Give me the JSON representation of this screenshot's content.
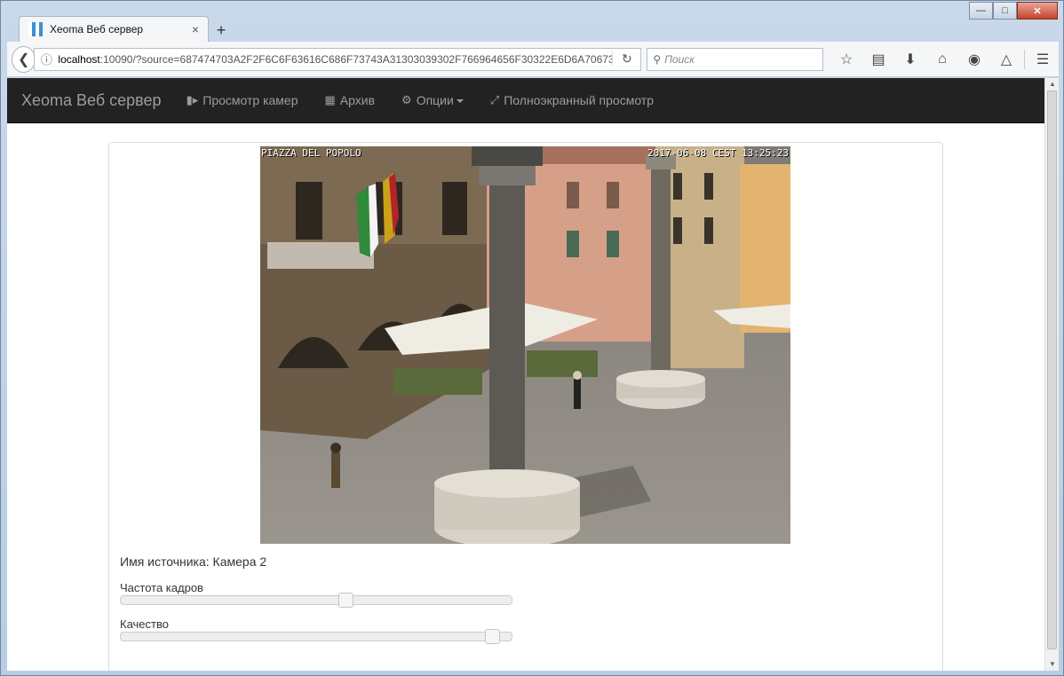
{
  "browser": {
    "tab_title": "Xeoma Веб сервер",
    "new_tab": "+",
    "tab_close": "×",
    "url_host": "localhost",
    "url_rest": ":10090/?source=687474703A2F2F6C6F63616C686F73743A31303039302F766964656F30322E6D6A70673F5",
    "search_placeholder": "Поиск"
  },
  "app": {
    "brand": "Xeoma Веб сервер",
    "nav": {
      "cameras": "Просмотр камер",
      "archive": "Архив",
      "options": "Опции",
      "fullscreen": "Полноэкранный просмотр"
    }
  },
  "camera": {
    "overlay_title": "PIAZZA DEL POPOLO",
    "overlay_timestamp": "2017-06-08 CEST 13:25:23",
    "source_label": "Имя источника: Камера 2",
    "framerate_label": "Частота кадров",
    "framerate_value": 0.58,
    "quality_label": "Качество",
    "quality_value": 0.97
  },
  "colors": {
    "navbar_bg": "#222222",
    "navbar_text": "#9d9d9d"
  }
}
